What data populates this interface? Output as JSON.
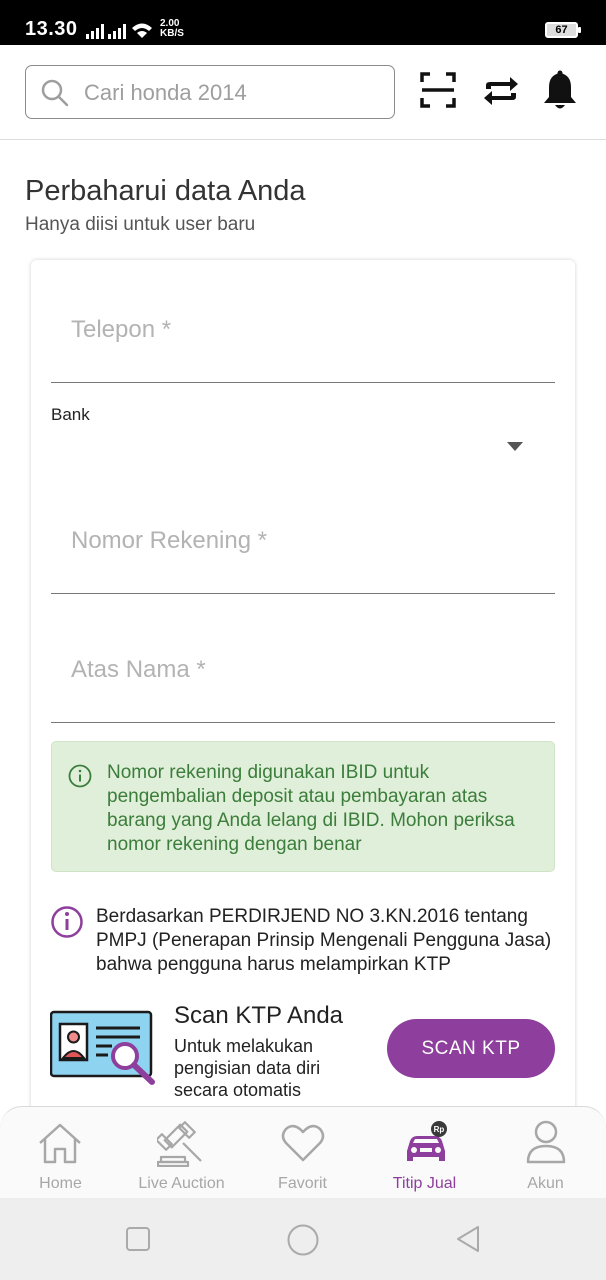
{
  "status_bar": {
    "time": "13.30",
    "net_speed_value": "2.00",
    "net_speed_unit": "KB/S",
    "battery": "67"
  },
  "header": {
    "search_placeholder": "Cari honda 2014",
    "icons": [
      "scan-icon",
      "swap-icon",
      "bell-icon"
    ]
  },
  "page": {
    "title": "Perbaharui data Anda",
    "subtitle": "Hanya diisi untuk user baru"
  },
  "form": {
    "phone_placeholder": "Telepon *",
    "bank_label": "Bank",
    "account_number_placeholder": "Nomor Rekening *",
    "account_name_placeholder": "Atas Nama *",
    "account_info": "Nomor rekening digunakan IBID untuk pengembalian deposit atau pembayaran atas barang yang Anda lelang di IBID. Mohon periksa nomor rekening dengan benar",
    "regulation_info": "Berdasarkan PERDIRJEND NO 3.KN.2016 tentang PMPJ (Penerapan Prinsip Mengenali Pengguna Jasa) bahwa pengguna harus melampirkan KTP"
  },
  "scan_ktp": {
    "title": "Scan KTP Anda",
    "description": "Untuk melakukan pengisian data diri secara otomatis",
    "button_label": "SCAN KTP"
  },
  "bottom_nav": {
    "items": [
      {
        "label": "Home",
        "icon": "home-icon"
      },
      {
        "label": "Live Auction",
        "icon": "gavel-icon"
      },
      {
        "label": "Favorit",
        "icon": "heart-icon"
      },
      {
        "label": "Titip Jual",
        "icon": "car-rp-icon",
        "active": true
      },
      {
        "label": "Akun",
        "icon": "person-icon"
      }
    ]
  },
  "colors": {
    "accent": "#8e3e9c",
    "info_green_bg": "#e0efd9",
    "info_green_text": "#3b7d3b"
  }
}
